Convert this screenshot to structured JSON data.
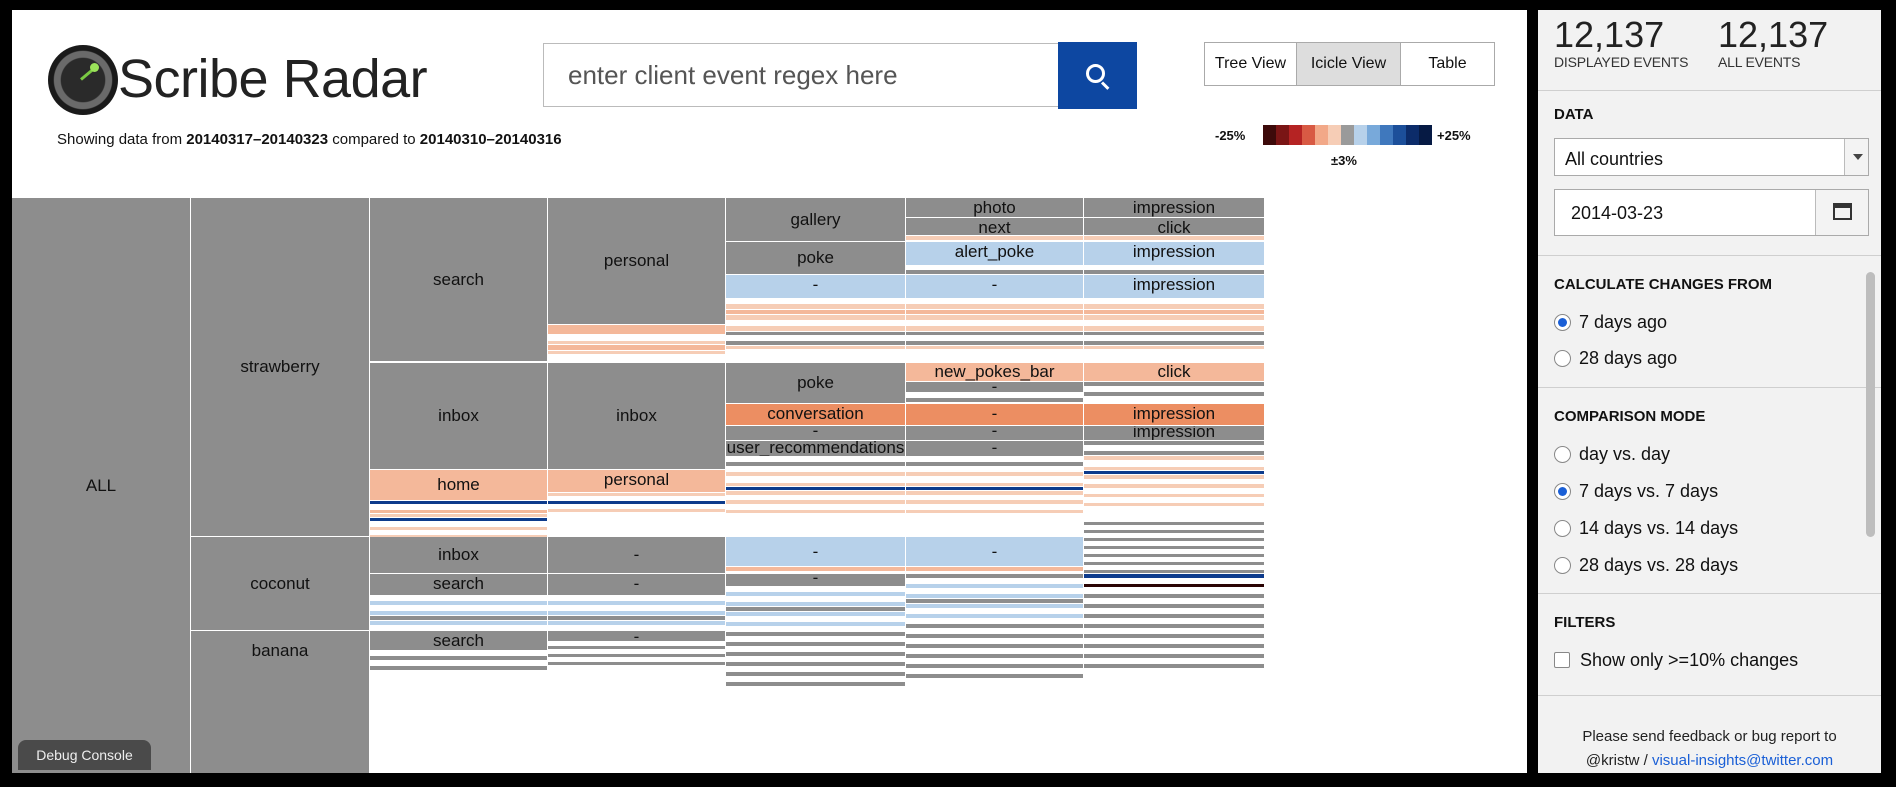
{
  "header": {
    "app_title": "Scribe Radar",
    "search": {
      "placeholder": "enter client event regex here"
    },
    "views": [
      {
        "label": "Tree View",
        "active": false
      },
      {
        "label": "Icicle View",
        "active": true
      },
      {
        "label": "Table",
        "active": false
      }
    ],
    "date_info": {
      "prefix": "Showing data from ",
      "current_range": "20140317–20140323",
      "middle": " compared to ",
      "previous_range": "20140310–20140316"
    },
    "legend": {
      "min_label": "-25%",
      "max_label": "+25%",
      "mid_label": "±3%",
      "colors": [
        "#3d0a0a",
        "#7a1515",
        "#b52323",
        "#d85a44",
        "#f2a888",
        "#f6cdb6",
        "#9a9a9a",
        "#b7d1ea",
        "#78a9da",
        "#3f78bd",
        "#1c4f9a",
        "#0c2c6a",
        "#061a44"
      ]
    }
  },
  "colors": {
    "gray": "#8d8d8d",
    "light_blue": "#b7d1ea",
    "light_salmon": "#f4b89a",
    "salmon": "#ec8e62",
    "pale_salmon": "#f6cdb6",
    "dark_blue": "#0d3b8c",
    "dark_red": "#2a0303",
    "white": "#ffffff"
  },
  "icicle": {
    "root": "ALL",
    "level1": [
      "strawberry",
      "coconut",
      "banana"
    ],
    "level2": [
      "search",
      "inbox",
      "home",
      "inbox",
      "search",
      "search"
    ],
    "level3": [
      "personal",
      "inbox",
      "personal",
      "-",
      "-",
      "-"
    ],
    "level4": [
      "gallery",
      "poke",
      "-",
      "poke",
      "conversation",
      "-",
      "user_recommendations",
      "-",
      "-"
    ],
    "level5": [
      "photo",
      "next",
      "alert_poke",
      "-",
      "new_pokes_bar",
      "-",
      "-",
      "-",
      "-",
      "-"
    ],
    "level6": [
      "impression",
      "click",
      "impression",
      "impression",
      "click",
      "impression",
      "impression"
    ]
  },
  "debug_console": "Debug Console",
  "sidebar": {
    "displayed_events": "12,137",
    "displayed_events_label": "DISPLAYED EVENTS",
    "all_events": "12,137",
    "all_events_label": "ALL EVENTS",
    "data_title": "DATA",
    "country": "All countries",
    "date": "2014-03-23",
    "calc_title": "CALCULATE CHANGES FROM",
    "calc_options": [
      {
        "label": "7 days ago",
        "selected": true
      },
      {
        "label": "28 days ago",
        "selected": false
      }
    ],
    "comparison_title": "COMPARISON MODE",
    "comparison_options": [
      {
        "label": "day vs. day",
        "selected": false
      },
      {
        "label": "7 days vs. 7 days",
        "selected": true
      },
      {
        "label": "14 days vs. 14 days",
        "selected": false
      },
      {
        "label": "28 days vs. 28 days",
        "selected": false
      }
    ],
    "filters_title": "FILTERS",
    "filter_label": "Show only >=10% changes",
    "feedback_line1": "Please send feedback or bug report to",
    "feedback_handle": "@kristw",
    "feedback_sep": " / ",
    "feedback_email": "visual-insights@twitter.com"
  }
}
